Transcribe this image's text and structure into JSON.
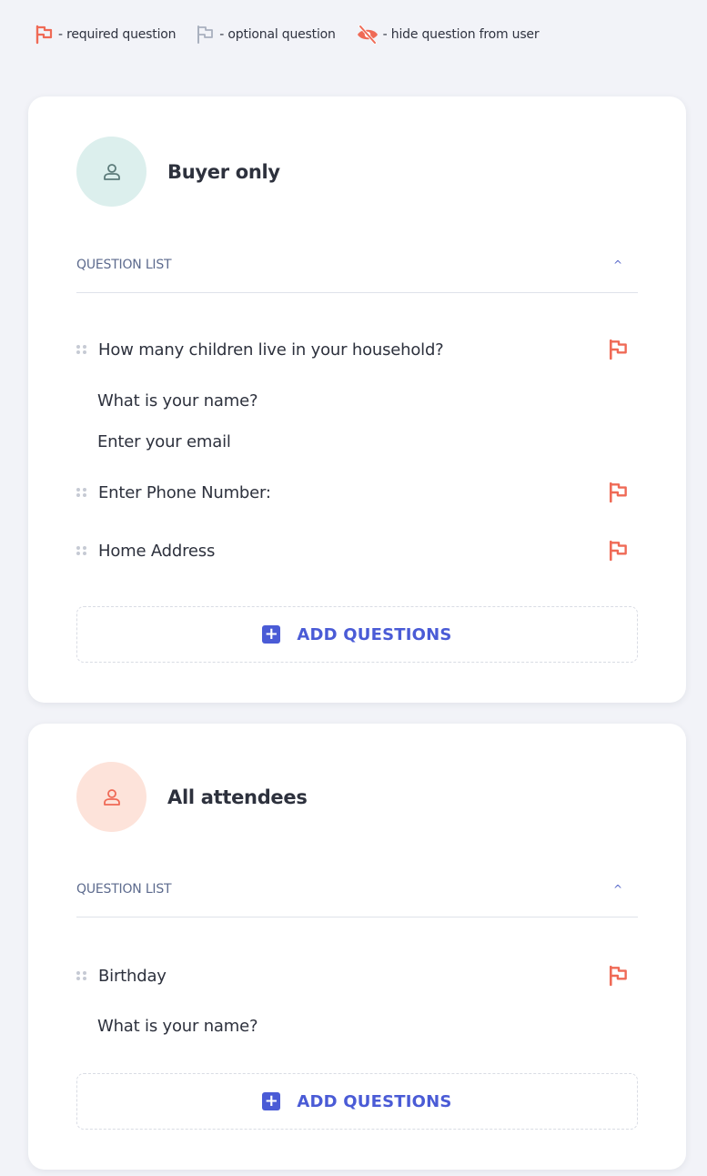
{
  "legend": {
    "required_label": "- required question",
    "optional_label": "- optional question",
    "hidden_label": "- hide question from user"
  },
  "colors": {
    "required_flag": "#ef6a56",
    "optional_flag": "#a9b0be",
    "accent": "#4a5bd6",
    "avatar_teal": "#dcefed",
    "avatar_peach": "#fde3da"
  },
  "sections": [
    {
      "title": "Buyer only",
      "icon": "user-icon",
      "list_label": "QUESTION LIST",
      "questions": [
        {
          "text": "How many children live in your household?",
          "draggable": true,
          "required": true
        },
        {
          "text": "What is your name?",
          "draggable": false,
          "required": false
        },
        {
          "text": "Enter your email",
          "draggable": false,
          "required": false
        },
        {
          "text": "Enter Phone Number:",
          "draggable": true,
          "required": true
        },
        {
          "text": "Home Address",
          "draggable": true,
          "required": true
        }
      ],
      "add_label": "ADD QUESTIONS"
    },
    {
      "title": "All attendees",
      "icon": "user-icon",
      "list_label": "QUESTION LIST",
      "questions": [
        {
          "text": "Birthday",
          "draggable": true,
          "required": true
        },
        {
          "text": "What is your name?",
          "draggable": false,
          "required": false
        }
      ],
      "add_label": "ADD QUESTIONS"
    }
  ]
}
